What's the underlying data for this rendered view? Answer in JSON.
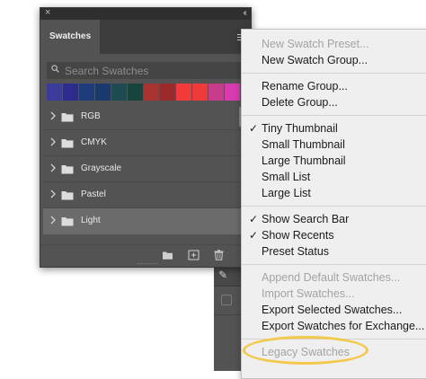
{
  "panel": {
    "tab_label": "Swatches",
    "search_placeholder": "Search Swatches",
    "recent_swatches": [
      "#3b3b9a",
      "#2c2c8e",
      "#1e3c7a",
      "#1a3a6e",
      "#1e4a52",
      "#17443c",
      "#a83232",
      "#9c2a2a",
      "#f23a3a",
      "#f03a3a",
      "#c83a8a",
      "#d83ab0"
    ],
    "groups": [
      {
        "label": "RGB"
      },
      {
        "label": "CMYK"
      },
      {
        "label": "Grayscale"
      },
      {
        "label": "Pastel"
      },
      {
        "label": "Light"
      }
    ],
    "selected_group": "Light"
  },
  "menu": {
    "items": [
      {
        "label": "New Swatch Preset...",
        "disabled": true,
        "checked": false
      },
      {
        "label": "New Swatch Group...",
        "disabled": false,
        "checked": false
      },
      {
        "label": "Rename Group...",
        "disabled": false,
        "checked": false
      },
      {
        "label": "Delete Group...",
        "disabled": false,
        "checked": false
      },
      {
        "label": "Tiny Thumbnail",
        "disabled": false,
        "checked": true
      },
      {
        "label": "Small Thumbnail",
        "disabled": false,
        "checked": false
      },
      {
        "label": "Large Thumbnail",
        "disabled": false,
        "checked": false
      },
      {
        "label": "Small List",
        "disabled": false,
        "checked": false
      },
      {
        "label": "Large List",
        "disabled": false,
        "checked": false
      },
      {
        "label": "Show Search Bar",
        "disabled": false,
        "checked": true
      },
      {
        "label": "Show Recents",
        "disabled": false,
        "checked": true
      },
      {
        "label": "Preset Status",
        "disabled": false,
        "checked": false
      },
      {
        "label": "Append Default Swatches...",
        "disabled": true,
        "checked": false
      },
      {
        "label": "Import Swatches...",
        "disabled": true,
        "checked": false
      },
      {
        "label": "Export Selected Swatches...",
        "disabled": false,
        "checked": false
      },
      {
        "label": "Export Swatches for Exchange...",
        "disabled": false,
        "checked": false
      },
      {
        "label": "Legacy Swatches",
        "disabled": true,
        "checked": false
      }
    ],
    "check_glyph": "✓",
    "highlight_color": "#f2c94c"
  },
  "icons": {
    "close": "close-icon",
    "collapse": "double-chevron-icon",
    "panel_menu": "hamburger-icon",
    "search": "search-icon",
    "folder": "folder-icon",
    "new_group": "new-folder-icon",
    "new_swatch": "new-swatch-icon",
    "delete": "trash-icon"
  }
}
